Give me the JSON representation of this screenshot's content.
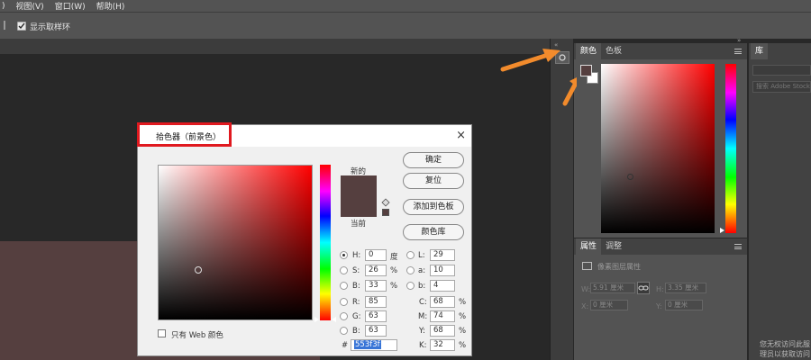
{
  "menubar": {
    "items": [
      ")",
      "视图(V)",
      "窗口(W)",
      "帮助(H)"
    ]
  },
  "optionsbar": {
    "checkbox_label": "显示取样环"
  },
  "color_panel": {
    "tabs": [
      "颜色",
      "色板"
    ],
    "foreground_color": "#553f3f",
    "background_color": "#ffffff"
  },
  "library_panel": {
    "tab": "库",
    "search_placeholder": "搜索 Adobe Stock",
    "message_line1": "您无权访问此服",
    "message_line2": "理员以获取访问"
  },
  "properties_panel": {
    "tabs": [
      "属性",
      "调整"
    ],
    "layer_label": "像素图层属性",
    "w_label": "W:",
    "w_value": "5.91 厘米",
    "h_label": "H:",
    "h_value": "3.35 厘米",
    "x_label": "X:",
    "x_value": "0 厘米",
    "y_label": "Y:",
    "y_value": "0 厘米"
  },
  "dialog": {
    "title": "拾色器（前景色）",
    "new_label": "新的",
    "current_label": "当前",
    "new_color": "#553f3f",
    "current_color": "#553f3f",
    "buttons": {
      "ok": "确定",
      "reset": "复位",
      "add_swatch": "添加到色板",
      "color_lib": "颜色库"
    },
    "web_only_label": "只有 Web 颜色",
    "hsb": {
      "h_label": "H:",
      "h": "0",
      "h_unit": "度",
      "s_label": "S:",
      "s": "26",
      "s_unit": "%",
      "b_label": "B:",
      "b": "33",
      "b_unit": "%"
    },
    "rgb": {
      "r_label": "R:",
      "r": "85",
      "g_label": "G:",
      "g": "63",
      "b_label": "B:",
      "b": "63"
    },
    "lab": {
      "l_label": "L:",
      "l": "29",
      "a_label": "a:",
      "a": "10",
      "b_label": "b:",
      "b": "4"
    },
    "cmyk": {
      "c_label": "C:",
      "c": "68",
      "m_label": "M:",
      "m": "74",
      "y_label": "Y:",
      "y": "68",
      "k_label": "K:",
      "k": "32",
      "unit": "%"
    },
    "hex_label": "#",
    "hex": "553f3f"
  },
  "colors": {
    "accent_arrow": "#f28b2c",
    "highlight_red": "#e0191f"
  }
}
